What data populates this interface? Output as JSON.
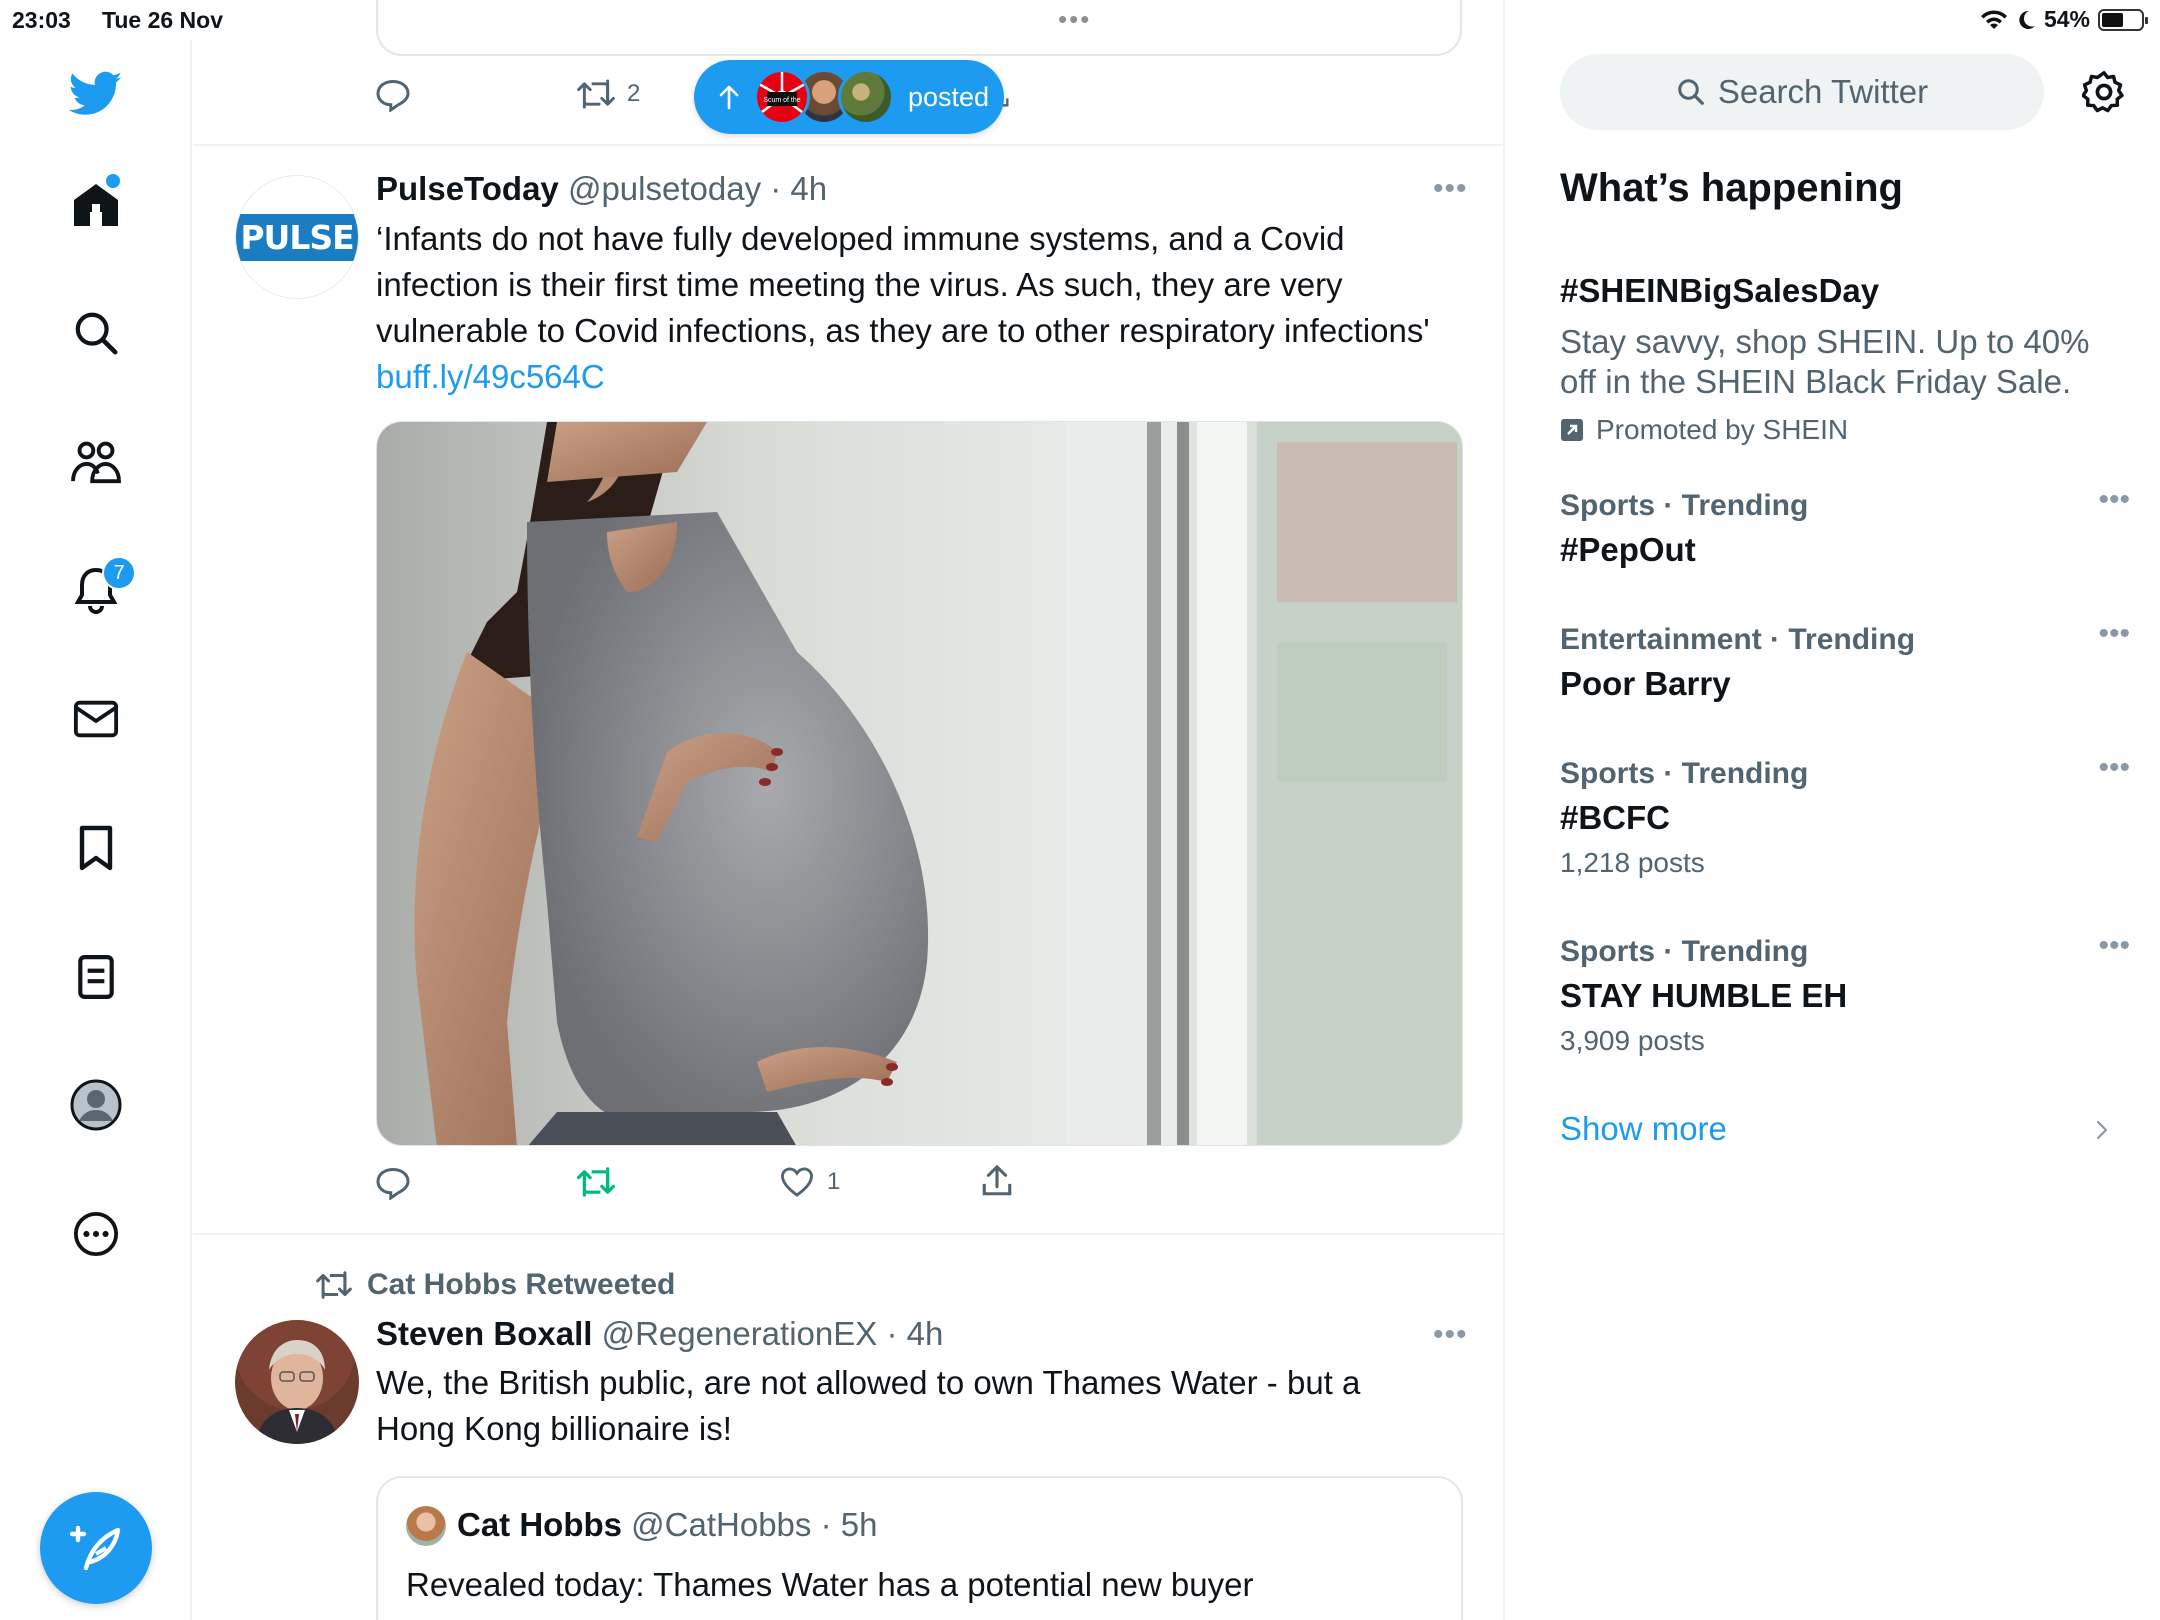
{
  "status": {
    "time": "23:03",
    "date": "Tue 26 Nov",
    "battery": "54%",
    "battery_level": 0.54
  },
  "nav": {
    "notifications_badge": "7"
  },
  "prev_tweet": {
    "retweets": "2"
  },
  "posted_pill": {
    "label": "posted",
    "avatar_text": "Scum of the"
  },
  "tweet1": {
    "name": "PulseToday",
    "handle": "@pulsetoday",
    "time": "· 4h",
    "avatar_text": "PULSE",
    "text": "‘Infants do not have fully developed immune systems, and a Covid infection is their first time meeting the virus. As such, they are very vulnerable to Covid infections, as they are to other respiratory infections' ",
    "link": "buff.ly/49c564C",
    "likes": "1"
  },
  "tweet2": {
    "retweeted_by": "Cat Hobbs Retweeted",
    "name": "Steven Boxall",
    "handle": "@RegenerationEX",
    "time": "· 4h",
    "text": "We, the British public, are not allowed to own Thames Water - but a Hong Kong billionaire is!",
    "quote": {
      "name": "Cat Hobbs",
      "handle": "@CatHobbs",
      "time": "· 5h",
      "text": "Revealed today: Thames Water has a potential new buyer"
    }
  },
  "sidebar": {
    "search_placeholder": "Search Twitter",
    "title": "What’s happening",
    "promo": {
      "name": "#SHEINBigSalesDay",
      "desc": "Stay savvy, shop SHEIN. Up to 40% off in the SHEIN Black Friday Sale.",
      "by": "Promoted by SHEIN"
    },
    "trends": [
      {
        "context": "Sports · Trending",
        "name": "#PepOut",
        "count": ""
      },
      {
        "context": "Entertainment · Trending",
        "name": "Poor Barry",
        "count": ""
      },
      {
        "context": "Sports · Trending",
        "name": "#BCFC",
        "count": "1,218 posts"
      },
      {
        "context": "Sports · Trending",
        "name": "STAY HUMBLE EH",
        "count": "3,909 posts"
      }
    ],
    "show_more": "Show more"
  },
  "colors": {
    "accent": "#1d9bf0",
    "retweet_green": "#00ba7c",
    "muted": "#536471"
  }
}
